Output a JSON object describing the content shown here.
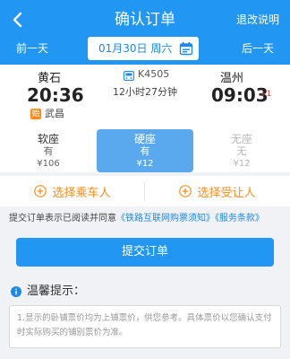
{
  "header": {
    "title": "确认订单",
    "refund_label": "退改说明",
    "prev_day_label": "前一天",
    "next_day_label": "后一天",
    "date": "01月30日 周六"
  },
  "train": {
    "from_station": "黄石",
    "depart_time": "20:36",
    "via_badge": "始",
    "via_station": "武昌",
    "train_no": "K4505",
    "duration": "12小时27分钟",
    "to_station": "温州",
    "arrive_time": "09:03",
    "day_offset": "+1"
  },
  "seats": [
    {
      "name": "软座",
      "availability": "有",
      "price": "¥106"
    },
    {
      "name": "硬座",
      "availability": "有",
      "price": "¥12"
    },
    {
      "name": "无座",
      "availability": "无",
      "price": "¥12"
    }
  ],
  "actions": {
    "select_passenger": "选择乘车人",
    "select_recipient": "选择受让人"
  },
  "agreement": {
    "prefix": "提交订单表示已阅读并同意",
    "notice_link": "《铁路互联网购票须知》",
    "terms_link": "《服务条款》"
  },
  "submit_label": "提交订单",
  "tips": {
    "title": "温馨提示：",
    "line1": "1.显示的卧铺票价均为上铺票价，供您参考。具体票价以您确认支付",
    "line2": "时实际购买的铺别票价为准。"
  },
  "colors": {
    "primary": "#2196f3",
    "selected_seat": "#5aa9ee",
    "accent_orange": "#ff8c1a",
    "link_blue": "#1e88e5"
  }
}
